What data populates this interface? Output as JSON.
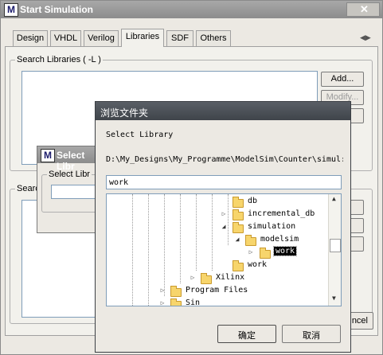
{
  "main_window": {
    "title": "Start Simulation",
    "tabs": [
      {
        "label": "Design"
      },
      {
        "label": "VHDL"
      },
      {
        "label": "Verilog"
      },
      {
        "label": "Libraries",
        "active": true
      },
      {
        "label": "SDF"
      },
      {
        "label": "Others"
      }
    ],
    "search_libraries_label": "Search Libraries ( -L )",
    "add_button": "Add...",
    "modify_button": "Modify...",
    "second_group_label": "Searc",
    "cancel_partial": "ncel"
  },
  "select_library_window": {
    "title": "Select Libr",
    "field_label": "Select Libr"
  },
  "browse_dialog": {
    "title": "浏览文件夹",
    "prompt": "Select Library",
    "path": "D:\\My_Designs\\My_Programme\\ModelSim\\Counter\\simul:",
    "folder_name_value": "work",
    "ok_button": "确定",
    "cancel_button": "取消",
    "tree": [
      {
        "label": "db",
        "expander": "none"
      },
      {
        "label": "incremental_db",
        "expander": "collapsed"
      },
      {
        "label": "simulation",
        "expander": "expanded"
      },
      {
        "label": "modelsim",
        "expander": "expanded"
      },
      {
        "label": "work",
        "expander": "collapsed",
        "selected": true
      },
      {
        "label": "work",
        "expander": "none"
      },
      {
        "label": "Xilinx",
        "expander": "collapsed"
      },
      {
        "label": "Program Files",
        "expander": "collapsed"
      },
      {
        "label": "Sin",
        "expander": "collapsed"
      }
    ]
  }
}
